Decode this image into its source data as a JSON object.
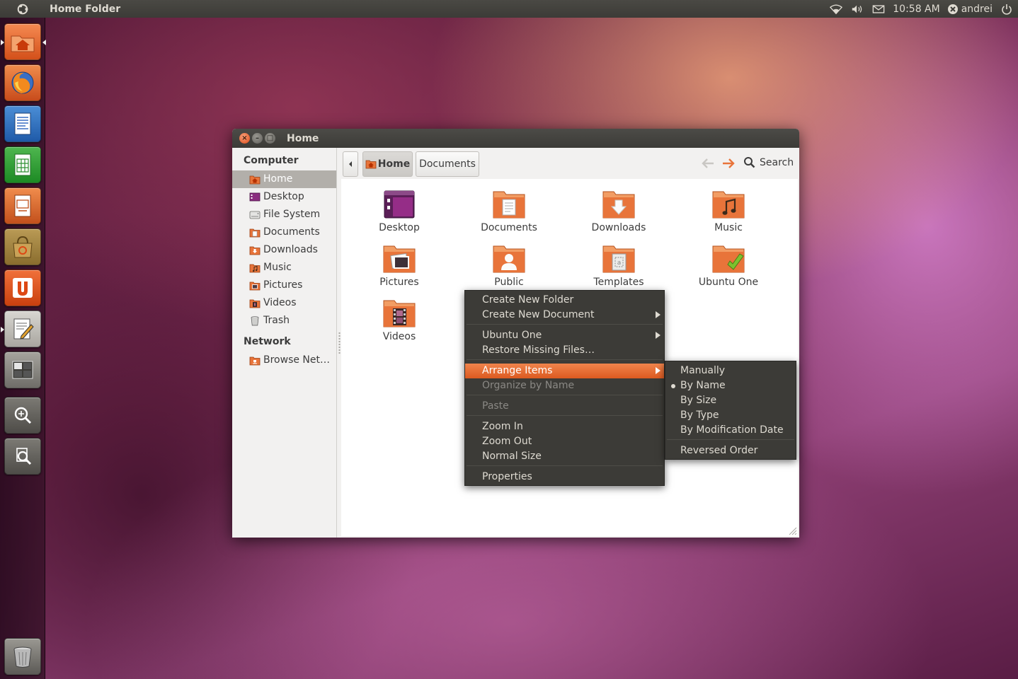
{
  "top_panel": {
    "window_title": "Home Folder",
    "clock": "10:58 AM",
    "user_name": "andrei",
    "icons": [
      "ubuntu-logo-icon",
      "wifi-icon",
      "volume-icon",
      "mail-icon",
      "user-status-icon",
      "power-icon"
    ]
  },
  "launcher": {
    "items": [
      "home-folder",
      "firefox",
      "libreoffice-writer",
      "libreoffice-calc",
      "libreoffice-impress",
      "ubuntu-software-center",
      "ubuntu-one",
      "text-editor",
      "workspace-switcher",
      "apps-lens",
      "files-lens",
      "trash"
    ]
  },
  "window": {
    "title": "Home",
    "sidebar": {
      "sections": [
        {
          "heading": "Computer",
          "items": [
            {
              "label": "Home",
              "selected": true
            },
            {
              "label": "Desktop",
              "selected": false
            },
            {
              "label": "File System",
              "selected": false
            },
            {
              "label": "Documents",
              "selected": false
            },
            {
              "label": "Downloads",
              "selected": false
            },
            {
              "label": "Music",
              "selected": false
            },
            {
              "label": "Pictures",
              "selected": false
            },
            {
              "label": "Videos",
              "selected": false
            },
            {
              "label": "Trash",
              "selected": false
            }
          ]
        },
        {
          "heading": "Network",
          "items": [
            {
              "label": "Browse Net…",
              "selected": false
            }
          ]
        }
      ]
    },
    "toolbar": {
      "breadcrumbs": [
        "Home",
        "Documents"
      ],
      "search_label": "Search"
    },
    "files": [
      {
        "name": "Desktop",
        "emblem": "desktop"
      },
      {
        "name": "Documents",
        "emblem": "documents"
      },
      {
        "name": "Downloads",
        "emblem": "downloads"
      },
      {
        "name": "Music",
        "emblem": "music"
      },
      {
        "name": "Pictures",
        "emblem": "pictures"
      },
      {
        "name": "Public",
        "emblem": "public"
      },
      {
        "name": "Templates",
        "emblem": "templates"
      },
      {
        "name": "Ubuntu One",
        "emblem": "ubuntu-one"
      },
      {
        "name": "Videos",
        "emblem": "videos"
      }
    ]
  },
  "context_menu": {
    "items": [
      {
        "label": "Create New Folder",
        "enabled": true
      },
      {
        "label": "Create New Document",
        "enabled": true,
        "submenu": true
      },
      {
        "label": "Ubuntu One",
        "enabled": true,
        "submenu": true
      },
      {
        "label": "Restore Missing Files…",
        "enabled": true
      },
      {
        "label": "Arrange Items",
        "enabled": true,
        "submenu": true,
        "active": true
      },
      {
        "label": "Organize by Name",
        "enabled": false
      },
      {
        "label": "Paste",
        "enabled": false
      },
      {
        "label": "Zoom In",
        "enabled": true
      },
      {
        "label": "Zoom Out",
        "enabled": true
      },
      {
        "label": "Normal Size",
        "enabled": true
      },
      {
        "label": "Properties",
        "enabled": true
      }
    ]
  },
  "arrange_submenu": {
    "items": [
      {
        "label": "Manually",
        "checked": false
      },
      {
        "label": "By Name",
        "checked": true
      },
      {
        "label": "By Size",
        "checked": false
      },
      {
        "label": "By Type",
        "checked": false
      },
      {
        "label": "By Modification Date",
        "checked": false
      },
      {
        "label": "Reversed Order",
        "checked": false
      }
    ]
  },
  "colors": {
    "panel_bg": "#3c3b37",
    "panel_text": "#dfdbd2",
    "accent_orange": "#dd4814",
    "menu_highlight": "#f07746",
    "sidebar_selected": "#b2afaa",
    "folder_orange": "#e8743a"
  }
}
